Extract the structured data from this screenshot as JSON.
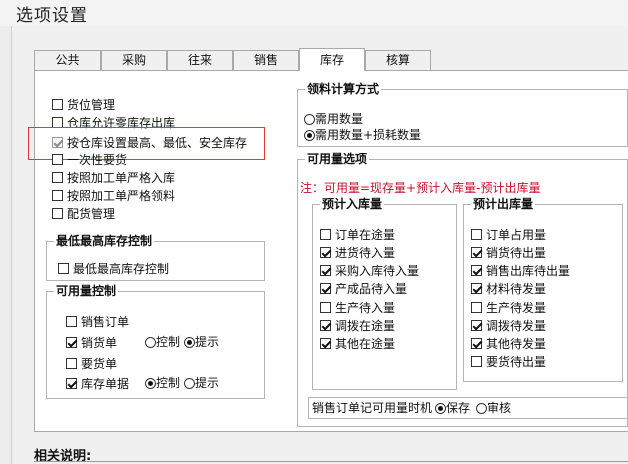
{
  "window": {
    "title": "选项设置"
  },
  "tabs": [
    {
      "label": "公共",
      "selected": false
    },
    {
      "label": "采购",
      "selected": false
    },
    {
      "label": "往来",
      "selected": false
    },
    {
      "label": "销售",
      "selected": false
    },
    {
      "label": "库存",
      "selected": true
    },
    {
      "label": "核算",
      "selected": false
    }
  ],
  "left_options": [
    {
      "label": "货位管理",
      "checked": false
    },
    {
      "label": "仓库允许零库存出库",
      "checked": false
    },
    {
      "label": "按仓库设置最高、最低、安全库存",
      "checked": true,
      "disabled": true,
      "highlighted": true
    },
    {
      "label": "一次性要货",
      "checked": false
    },
    {
      "label": "按照加工单严格入库",
      "checked": false
    },
    {
      "label": "按照加工单严格领料",
      "checked": false
    },
    {
      "label": "配货管理",
      "checked": false
    }
  ],
  "stock_limit": {
    "title": "最低最高库存控制",
    "option": {
      "label": "最低最高库存控制",
      "checked": false
    }
  },
  "available_control": {
    "title": "可用量控制",
    "items": [
      {
        "label": "销售订单",
        "checked": false,
        "radios": null
      },
      {
        "label": "销货单",
        "checked": true,
        "radios": {
          "control": "控制",
          "prompt": "提示",
          "selected": "prompt"
        }
      },
      {
        "label": "要货单",
        "checked": false,
        "radios": null
      },
      {
        "label": "库存单据",
        "checked": true,
        "radios": {
          "control": "控制",
          "prompt": "提示",
          "selected": "control"
        }
      }
    ]
  },
  "material_calc": {
    "title": "领料计算方式",
    "options": [
      {
        "label": "需用数量",
        "selected": false
      },
      {
        "label": "需用数量+损耗数量",
        "selected": true
      }
    ]
  },
  "available_options": {
    "title": "可用量选项",
    "note": "注：可用量=现存量+预计入库量-预计出库量",
    "expected_in": {
      "title": "预计入库量",
      "items": [
        {
          "label": "订单在途量",
          "checked": false
        },
        {
          "label": "进货待入量",
          "checked": true
        },
        {
          "label": "采购入库待入量",
          "checked": true
        },
        {
          "label": "产成品待入量",
          "checked": true
        },
        {
          "label": "生产待入量",
          "checked": false
        },
        {
          "label": "调拨在途量",
          "checked": true
        },
        {
          "label": "其他在途量",
          "checked": true
        }
      ]
    },
    "expected_out": {
      "title": "预计出库量",
      "items": [
        {
          "label": "订单占用量",
          "checked": false
        },
        {
          "label": "销货待出量",
          "checked": true
        },
        {
          "label": "销售出库待出量",
          "checked": true
        },
        {
          "label": "材料待发量",
          "checked": true
        },
        {
          "label": "生产待发量",
          "checked": false
        },
        {
          "label": "调拨待发量",
          "checked": true
        },
        {
          "label": "其他待发量",
          "checked": true
        },
        {
          "label": "要货待出量",
          "checked": false
        }
      ]
    },
    "timing": {
      "label": "销售订单记可用量时机",
      "options": [
        {
          "label": "保存",
          "selected": true
        },
        {
          "label": "审核",
          "selected": false
        }
      ]
    }
  },
  "footer": {
    "label": "相关说明:"
  }
}
